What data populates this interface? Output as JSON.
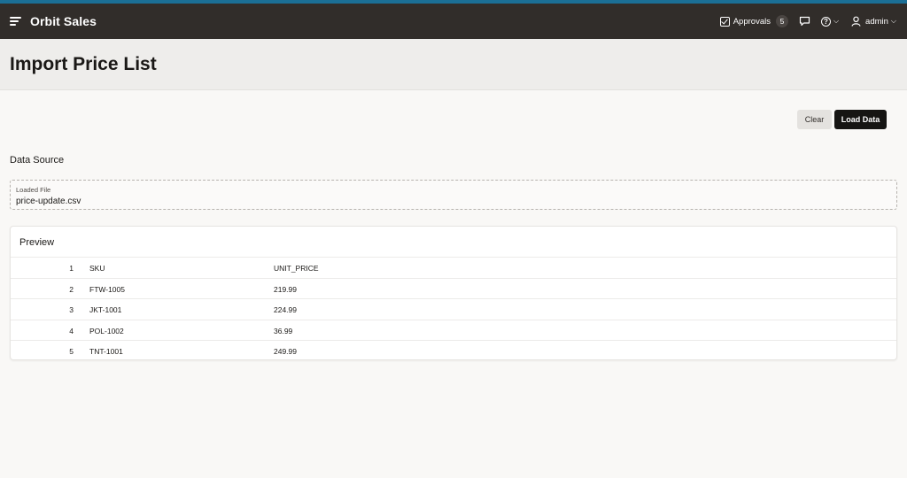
{
  "app": {
    "title": "Orbit Sales"
  },
  "header": {
    "approvals_label": "Approvals",
    "approvals_count": "5",
    "user": "admin"
  },
  "page": {
    "title": "Import Price List"
  },
  "actions": {
    "clear": "Clear",
    "load": "Load Data"
  },
  "data_source": {
    "section_title": "Data Source",
    "loaded_file_label": "Loaded File",
    "loaded_file_value": "price-update.csv"
  },
  "preview": {
    "title": "Preview",
    "rows": [
      {
        "num": "1",
        "a": "SKU",
        "b": "UNIT_PRICE"
      },
      {
        "num": "2",
        "a": "FTW-1005",
        "b": "219.99"
      },
      {
        "num": "3",
        "a": "JKT-1001",
        "b": "224.99"
      },
      {
        "num": "4",
        "a": "POL-1002",
        "b": "36.99"
      },
      {
        "num": "5",
        "a": "TNT-1001",
        "b": "249.99"
      }
    ]
  },
  "colors": {
    "accent": "#1b6f96",
    "header_bg": "#312d2a",
    "primary_button": "#161513"
  },
  "icons": [
    "menu-icon",
    "checkbox-icon",
    "chat-icon",
    "help-icon",
    "chevron-down-icon",
    "user-icon"
  ]
}
